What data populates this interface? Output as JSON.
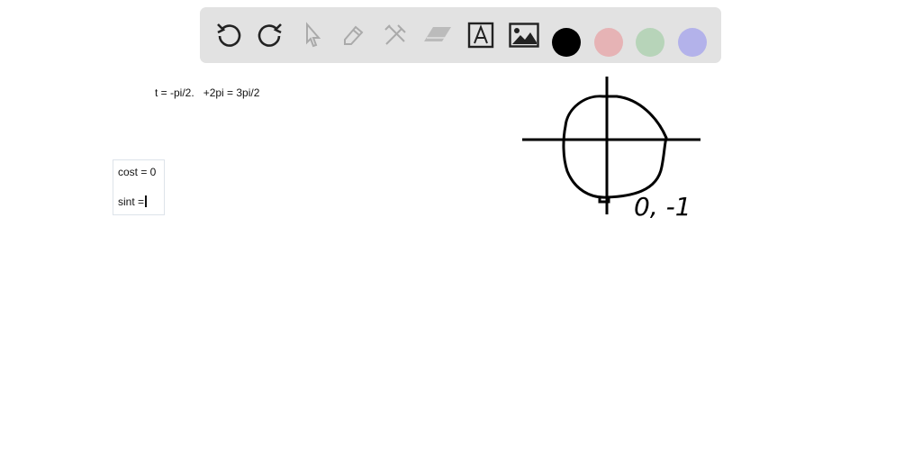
{
  "toolbar": {
    "tools": [
      {
        "name": "undo-icon",
        "enabled": true
      },
      {
        "name": "redo-icon",
        "enabled": true
      },
      {
        "name": "select-arrow-icon",
        "enabled": false
      },
      {
        "name": "pen-icon",
        "enabled": false
      },
      {
        "name": "tools-icon",
        "enabled": false
      },
      {
        "name": "eraser-icon",
        "enabled": false
      },
      {
        "name": "text-icon",
        "enabled": true
      },
      {
        "name": "image-icon",
        "enabled": true
      }
    ],
    "colors": [
      "#000000",
      "#e6b3b5",
      "#b7d4b9",
      "#b3b2ea"
    ],
    "selected_color": "#000000"
  },
  "canvas": {
    "line1": "t = -pi/2.   +2pi = 3pi/2",
    "textbox": {
      "line1": "cost = 0",
      "line2": "sint ="
    },
    "sketch_label": "0, -1"
  }
}
